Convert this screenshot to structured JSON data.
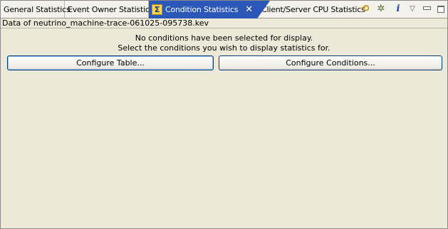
{
  "tabs": [
    {
      "label": "General Statistics"
    },
    {
      "label": "Event Owner Statistics"
    },
    {
      "label": "Condition Statistics",
      "active": true,
      "icon": "sigma-icon"
    },
    {
      "label": "Client/Server CPU Statistics"
    }
  ],
  "toolbar": {
    "icons": [
      "sync-icon",
      "configure-icon",
      "info-icon",
      "view-menu-icon",
      "minimize-icon",
      "maximize-icon"
    ]
  },
  "infobar": {
    "text": "Data of neutrino_machine-trace-061025-095738.kev"
  },
  "main": {
    "message_line1": "No conditions have been selected for display.",
    "message_line2": "Select the conditions you wish to display statistics for.",
    "configure_table_label": "Configure Table...",
    "configure_conditions_label": "Configure Conditions..."
  },
  "colors": {
    "active_tab": "#2a57b8",
    "panel_background": "#ece9d8"
  }
}
